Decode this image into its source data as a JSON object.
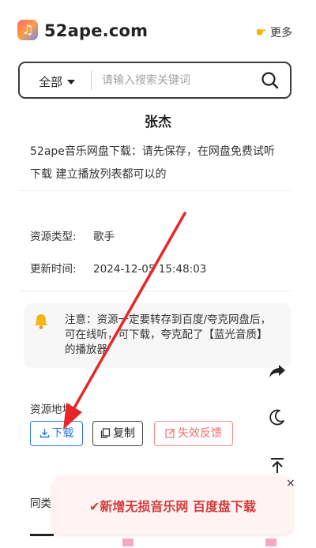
{
  "header": {
    "brand": "52ape.com",
    "more_label": "更多"
  },
  "search": {
    "scope": "全部",
    "placeholder": "请输入搜索关键词"
  },
  "detail": {
    "title": "张杰",
    "description": "52ape音乐网盘下载：请先保存，在网盘免费试听 下载 建立播放列表都可以的",
    "type_label": "资源类型:",
    "type_value": "歌手",
    "updated_label": "更新时间:",
    "updated_value": "2024-12-05 15:48:03",
    "notice": "注意：资源一定要转存到百度/夸克网盘后，可在线听，可下载，夸克配了【蓝光音质】的播放器"
  },
  "resources": {
    "label": "资源地址",
    "download_button": "下载",
    "copy_button": "复制",
    "feedback_button": "失效反馈"
  },
  "tabs": {
    "similar": "同类"
  },
  "banner": {
    "text": "✔新增无损音乐网 百度盘下载",
    "close": "×"
  },
  "colors": {
    "accent_blue": "#2a78e4",
    "feedback_red": "#ec6d6d",
    "banner_red": "#d33a3a",
    "annotation_arrow": "#e8262a"
  },
  "icons": {
    "logo": "music-note-icon",
    "more": "pointing-hand-icon",
    "search": "magnifier-icon",
    "notice": "bell-icon",
    "download": "download-icon",
    "copy": "copy-icon",
    "feedback": "edit-icon",
    "share": "share-icon",
    "theme": "moon-icon",
    "top": "back-to-top-icon"
  }
}
